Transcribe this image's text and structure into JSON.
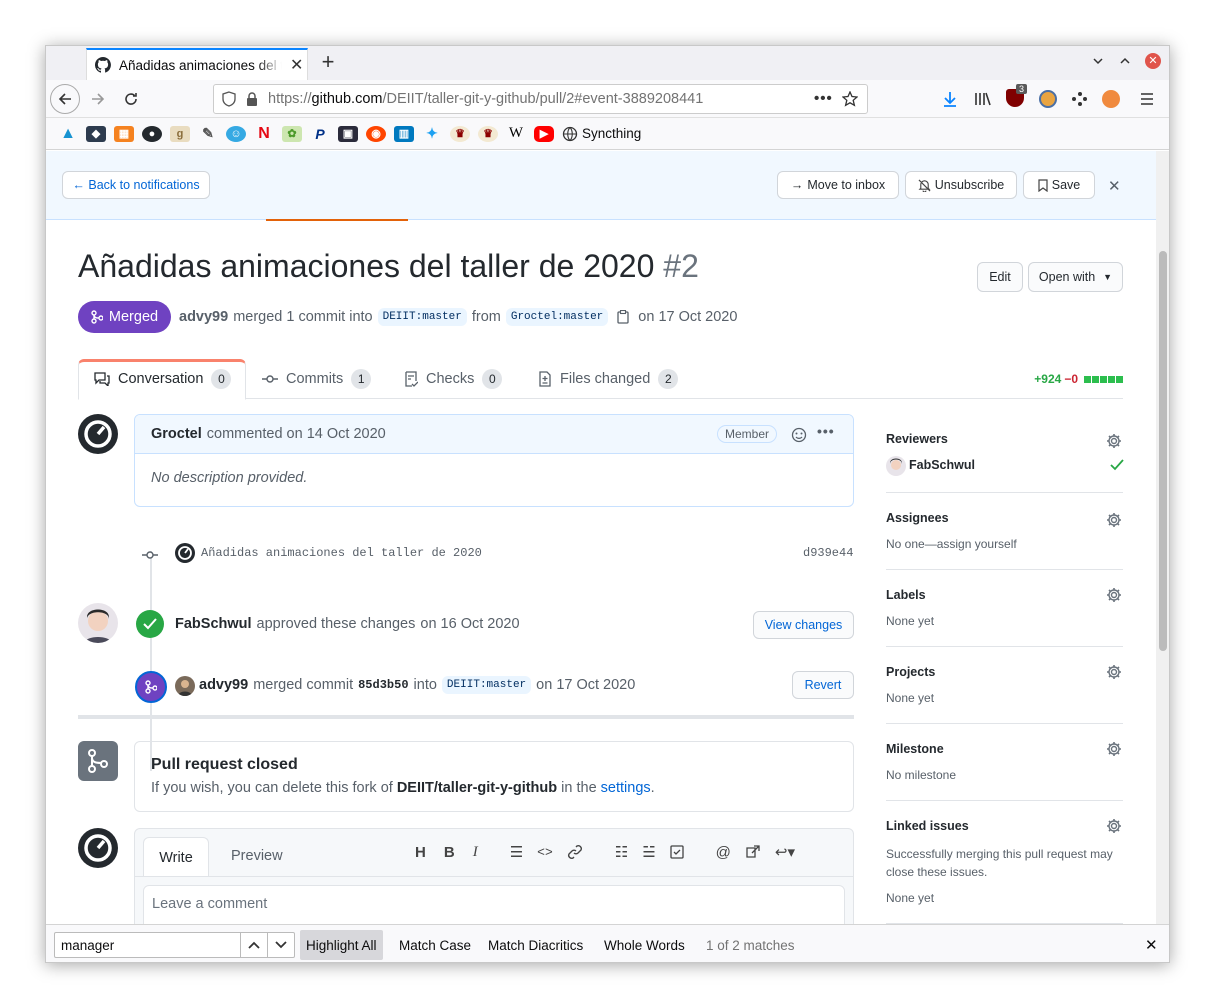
{
  "browser": {
    "tab_title": "Añadidas animaciones del taller",
    "url_prefix": "https://",
    "url_domain": "github.com",
    "url_path": "/DEIIT/taller-git-y-github/pull/2#event-3889208441",
    "ublock_badge": "3",
    "bookmarks": [
      {
        "icon": "arch-icon",
        "color": "#1793d1"
      },
      {
        "icon": "cube-icon",
        "color": "#2d3b4e"
      },
      {
        "icon": "grid-icon",
        "color": "#f58220"
      },
      {
        "icon": "github-icon",
        "color": "#24292e"
      },
      {
        "icon": "goodreads-icon",
        "color": "#c8a46e"
      },
      {
        "icon": "feather-icon",
        "color": "#555"
      },
      {
        "icon": "face-icon",
        "color": "#35a9e3"
      },
      {
        "icon": "netflix-icon",
        "color": "#e50914"
      },
      {
        "icon": "leaf-icon",
        "color": "#4c9a2a"
      },
      {
        "icon": "paypal-icon",
        "color": "#003087"
      },
      {
        "icon": "portal-icon",
        "color": "#2b2b3b"
      },
      {
        "icon": "reddit-icon",
        "color": "#ff4500"
      },
      {
        "icon": "trello-icon",
        "color": "#0079bf"
      },
      {
        "icon": "twitter-icon",
        "color": "#1da1f2"
      },
      {
        "icon": "crest-icon",
        "color": "#8b0000"
      },
      {
        "icon": "crest-icon",
        "color": "#8b0000"
      },
      {
        "icon": "wikipedia-icon",
        "color": "#000"
      },
      {
        "icon": "youtube-icon",
        "color": "#ff0000"
      }
    ],
    "syncthing_label": "Syncthing"
  },
  "notification_bar": {
    "back_label": "← Back to notifications",
    "inbox_label": "Move to inbox",
    "unsubscribe_label": "Unsubscribe",
    "save_label": "Save"
  },
  "pr": {
    "title": "Añadidas animaciones del taller de 2020",
    "number": "#2",
    "edit_label": "Edit",
    "open_with_label": "Open with",
    "state_label": "Merged",
    "author": "advy99",
    "merged_text": "merged 1 commit into",
    "base_branch_org": "DEIIT",
    "base_branch_name": ":master",
    "from_text": "from",
    "head_branch_org": "Groctel",
    "head_branch_name": ":master",
    "merged_date": "on 17 Oct 2020"
  },
  "tabs": [
    {
      "label": "Conversation",
      "count": "0"
    },
    {
      "label": "Commits",
      "count": "1"
    },
    {
      "label": "Checks",
      "count": "0"
    },
    {
      "label": "Files changed",
      "count": "2"
    }
  ],
  "diffstat": {
    "additions": "+924",
    "deletions": "−0"
  },
  "timeline": {
    "comment_author": "Groctel",
    "comment_meta": "commented on 14 Oct 2020",
    "member_badge": "Member",
    "comment_body": "No description provided.",
    "commit_message": "Añadidas animaciones del taller de 2020",
    "commit_sha": "d939e44",
    "review_author": "FabSchwul",
    "review_text": "approved these changes",
    "review_date": "on 16 Oct 2020",
    "view_changes_label": "View changes",
    "merge_author": "advy99",
    "merge_text": "merged commit",
    "merge_sha": "85d3b50",
    "merge_into": "into",
    "merge_branch_org": "DEIIT",
    "merge_branch_name": ":master",
    "merge_date": "on 17 Oct 2020",
    "revert_label": "Revert",
    "closed_title": "Pull request closed",
    "closed_prefix": "If you wish, you can delete this fork of",
    "closed_repo": "DEIIT/taller-git-y-github",
    "closed_mid": "in the",
    "closed_link": "settings",
    "closed_end": "."
  },
  "composer": {
    "write_tab": "Write",
    "preview_tab": "Preview",
    "placeholder": "Leave a comment"
  },
  "sidebar": {
    "reviewers_heading": "Reviewers",
    "reviewer_name": "FabSchwul",
    "assignees_heading": "Assignees",
    "assignees_value": "No one—assign yourself",
    "labels_heading": "Labels",
    "labels_value": "None yet",
    "projects_heading": "Projects",
    "projects_value": "None yet",
    "milestone_heading": "Milestone",
    "milestone_value": "No milestone",
    "linked_heading": "Linked issues",
    "linked_desc": "Successfully merging this pull request may close these issues.",
    "linked_value": "None yet"
  },
  "findbar": {
    "query": "manager",
    "highlight_all": "Highlight All",
    "match_case": "Match Case",
    "match_diacritics": "Match Diacritics",
    "whole_words": "Whole Words",
    "result": "1 of 2 matches"
  }
}
